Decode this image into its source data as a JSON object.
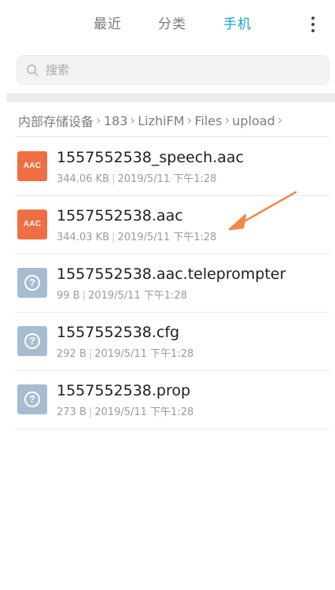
{
  "tabs": [
    {
      "label": "最近",
      "active": false
    },
    {
      "label": "分类",
      "active": false
    },
    {
      "label": "手机",
      "active": true
    }
  ],
  "accent_color": "#1aa3c9",
  "search": {
    "placeholder": "搜索",
    "value": ""
  },
  "breadcrumb": [
    "内部存储设备",
    "183",
    "LizhiFM",
    "Files",
    "upload"
  ],
  "files": [
    {
      "name": "1557552538_speech.aac",
      "size": "344.06 KB",
      "date": "2019/5/11 下午1:28",
      "icon": "aac-file-icon",
      "icon_label": "AAC",
      "icon_color": "#ef6f43"
    },
    {
      "name": "1557552538.aac",
      "size": "344.03 KB",
      "date": "2019/5/11 下午1:28",
      "icon": "aac-file-icon",
      "icon_label": "AAC",
      "icon_color": "#ef6f43"
    },
    {
      "name": "1557552538.aac.teleprompter",
      "size": "99 B",
      "date": "2019/5/11 下午1:28",
      "icon": "unknown-file-icon",
      "icon_color": "#a6bcd0"
    },
    {
      "name": "1557552538.cfg",
      "size": "292 B",
      "date": "2019/5/11 下午1:28",
      "icon": "unknown-file-icon",
      "icon_color": "#a6bcd0"
    },
    {
      "name": "1557552538.prop",
      "size": "273 B",
      "date": "2019/5/11 下午1:28",
      "icon": "unknown-file-icon",
      "icon_color": "#a6bcd0"
    }
  ],
  "annotation_arrow_color": "#ef8a4a"
}
